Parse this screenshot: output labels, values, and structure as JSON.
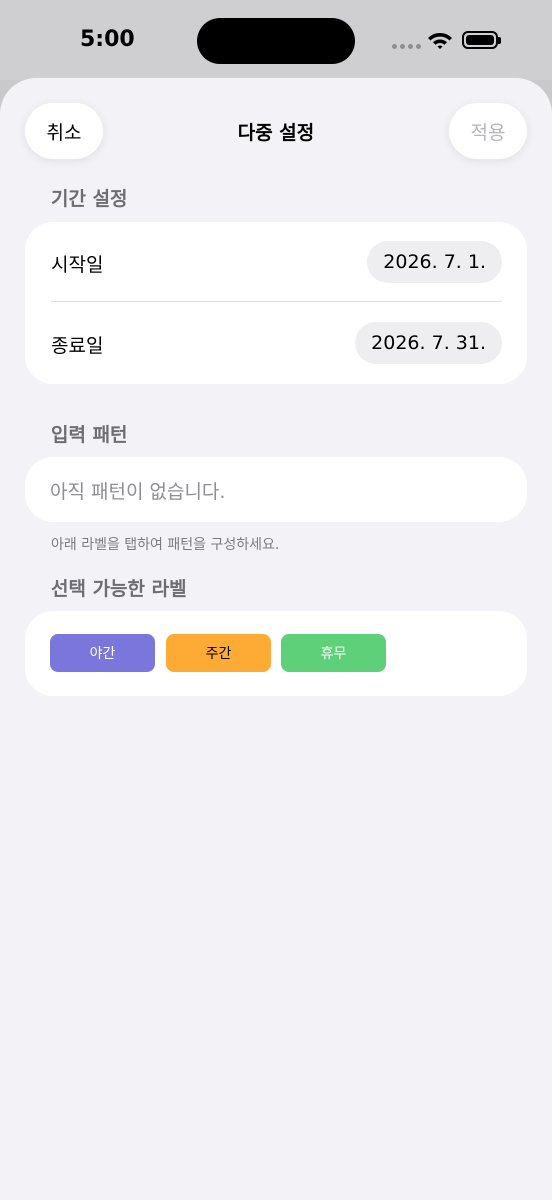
{
  "status_bar": {
    "time": "5:00"
  },
  "nav": {
    "cancel_label": "취소",
    "title": "다중 설정",
    "apply_label": "적용"
  },
  "period": {
    "header": "기간 설정",
    "start_label": "시작일",
    "start_value": "2026. 7. 1.",
    "end_label": "종료일",
    "end_value": "2026. 7. 31."
  },
  "pattern": {
    "header": "입력 패턴",
    "placeholder": "아직 패턴이 없습니다.",
    "hint": "아래 라벨을 탭하여 패턴을 구성하세요."
  },
  "labels": {
    "header": "선택 가능한 라벨",
    "items": [
      {
        "label": "야간",
        "color": "#7b76db",
        "text_color": "#ffffff"
      },
      {
        "label": "주간",
        "color": "#fdab34",
        "text_color": "#000000"
      },
      {
        "label": "휴무",
        "color": "#5fd07a",
        "text_color": "#ffffff"
      }
    ]
  }
}
